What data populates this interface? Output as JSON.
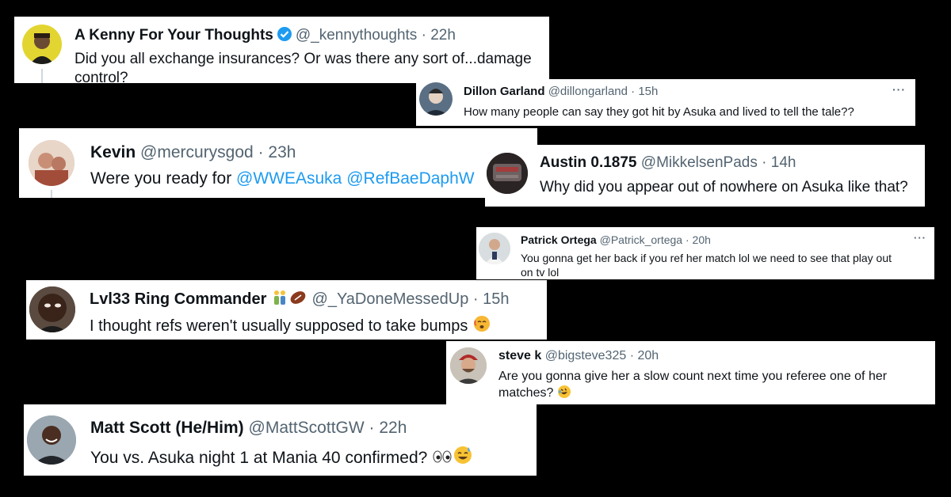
{
  "colors": {
    "background": "#000000",
    "card": "#ffffff",
    "mention": "#1d9bf0",
    "verified": "#1d9bf0",
    "muted": "#536471"
  },
  "tweets": [
    {
      "name": "A Kenny For Your Thoughts",
      "verified": true,
      "handle": "@_kennythoughts",
      "time": "· 22h",
      "lines": [
        "Did you all exchange insurances? Or was there any sort of...damage",
        "control?"
      ]
    },
    {
      "name": "Dillon Garland",
      "handle": "@dillongarland",
      "time": "· 15h",
      "more": "···",
      "text": "How many people can say they got hit by Asuka and lived to tell the tale??"
    },
    {
      "name": "Kevin",
      "handle": "@mercurysgod",
      "time": "· 23h",
      "text_prefix": "Were you ready for ",
      "mention1": "@WWEAsuka",
      "mention2": "@RefBaeDaphW"
    },
    {
      "name": "Austin 0.1875",
      "handle": "@MikkelsenPads",
      "time": "· 14h",
      "text": "Why did you appear out of nowhere on Asuka like that?"
    },
    {
      "name": "Patrick Ortega",
      "handle": "@Patrick_ortega",
      "time": "· 20h",
      "more": "···",
      "lines": [
        "You gonna get her back if you ref her match lol we need to see that play out",
        "on tv lol"
      ]
    },
    {
      "name": "Lvl33 Ring Commander",
      "name_icons": [
        "wrestling-emoji",
        "football-emoji"
      ],
      "handle": "@_YaDoneMessedUp",
      "time": "· 15h",
      "text": "I thought refs weren't usually supposed to take bumps",
      "text_icon": "face-exhaling-emoji"
    },
    {
      "name": "steve k",
      "handle": "@bigsteve325",
      "time": "· 20h",
      "lines": [
        "Are you gonna give her a slow count next time you referee one of her",
        "matches?"
      ],
      "text_icon": "rolling-laughing-emoji"
    },
    {
      "name": "Matt Scott (He/Him)",
      "handle": "@MattScottGW",
      "time": "· 22h",
      "text": "You vs. Asuka night 1 at Mania 40 confirmed?",
      "text_icons": [
        "eyes-emoji",
        "sweat-smile-emoji"
      ]
    }
  ]
}
